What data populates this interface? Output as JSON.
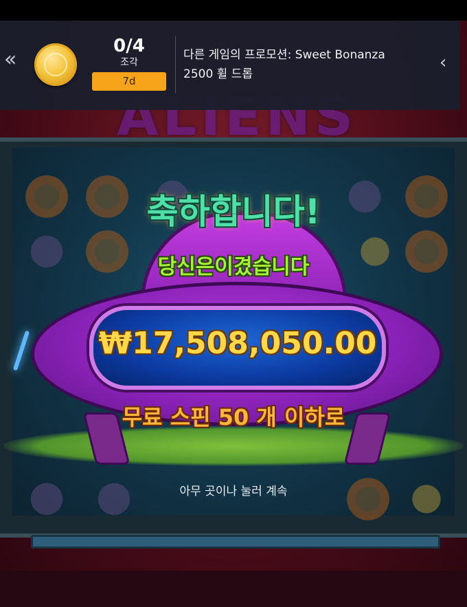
{
  "promo": {
    "pieces_count": "0/4",
    "pieces_label": "조각",
    "days_left": "7d",
    "line1": "다른 게임의 프로모션: Sweet Bonanza",
    "line2": "2500 휠 드롭",
    "prev_icon": "«",
    "next_icon": "‹"
  },
  "win": {
    "congrats": "축하합니다!",
    "you_won": "당신은이겼습니다",
    "amount": "₩17,508,050.00",
    "free_spins": "무료 스핀 50 개 이하로",
    "tap_continue": "아무 곳이나 눌러 계속"
  },
  "colors": {
    "badge": "#f7a41a",
    "promo_bg": "#1b1e2c",
    "ufo": "#9b2acb",
    "amount_text": "#ffd84a"
  }
}
